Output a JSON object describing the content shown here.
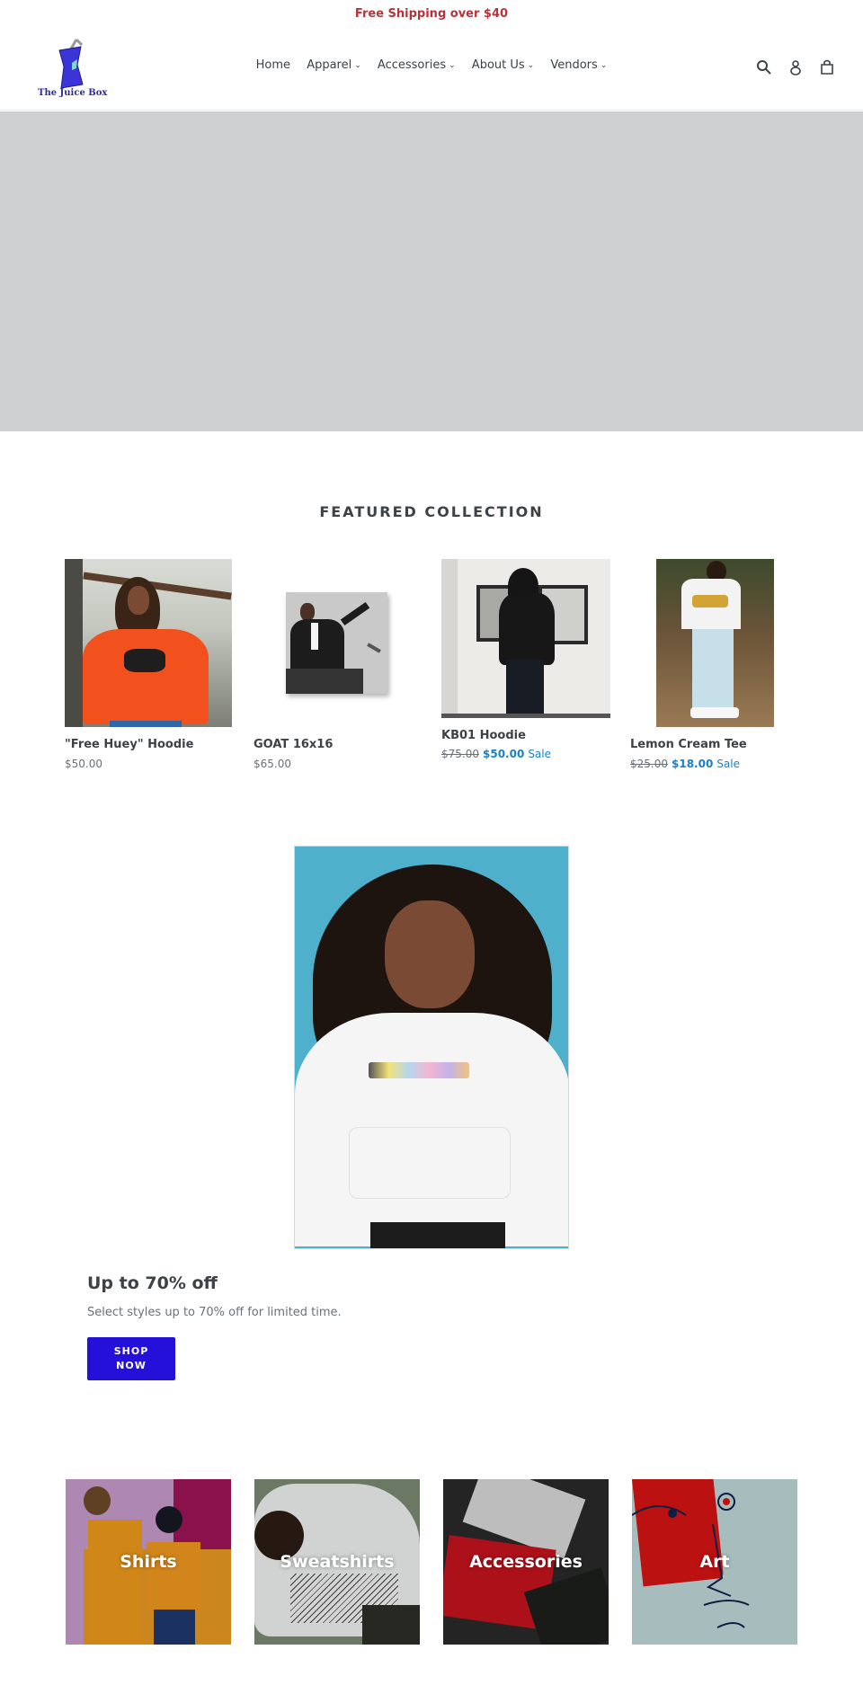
{
  "announcement": {
    "text": "Free Shipping over $40",
    "color": "#b5343b"
  },
  "header": {
    "logo_text": "The Juice Box",
    "nav": [
      {
        "label": "Home",
        "has_dropdown": false
      },
      {
        "label": "Apparel",
        "has_dropdown": true
      },
      {
        "label": "Accessories",
        "has_dropdown": true
      },
      {
        "label": "About Us",
        "has_dropdown": true
      },
      {
        "label": "Vendors",
        "has_dropdown": true
      }
    ],
    "icons": [
      "search-icon",
      "account-icon",
      "cart-icon"
    ]
  },
  "hero": {
    "background": "#cfd0d2"
  },
  "featured": {
    "title": "FEATURED COLLECTION",
    "products": [
      {
        "title": "\"Free Huey\" Hoodie",
        "price": "$50.00",
        "compare_price": null,
        "sale_label": null
      },
      {
        "title": "GOAT 16x16",
        "price": "$65.00",
        "compare_price": null,
        "sale_label": null
      },
      {
        "title": "KB01 Hoodie",
        "price": "$50.00",
        "compare_price": "$75.00",
        "sale_label": "Sale"
      },
      {
        "title": "Lemon Cream Tee",
        "price": "$18.00",
        "compare_price": "$25.00",
        "sale_label": "Sale"
      }
    ]
  },
  "promo": {
    "image_alt": "Model in white VANGUARD hoodie",
    "heading": "Up to 70% off",
    "text": "Select styles up to 70% off for limited time.",
    "button_line1": "SHOP",
    "button_line2": "NOW",
    "button_color": "#2410d8"
  },
  "collections": [
    {
      "label": "Shirts"
    },
    {
      "label": "Sweatshirts"
    },
    {
      "label": "Accessories"
    },
    {
      "label": "Art"
    }
  ],
  "colors": {
    "sale": "#1a82c4",
    "text": "#3d4246",
    "muted": "#69727b"
  }
}
